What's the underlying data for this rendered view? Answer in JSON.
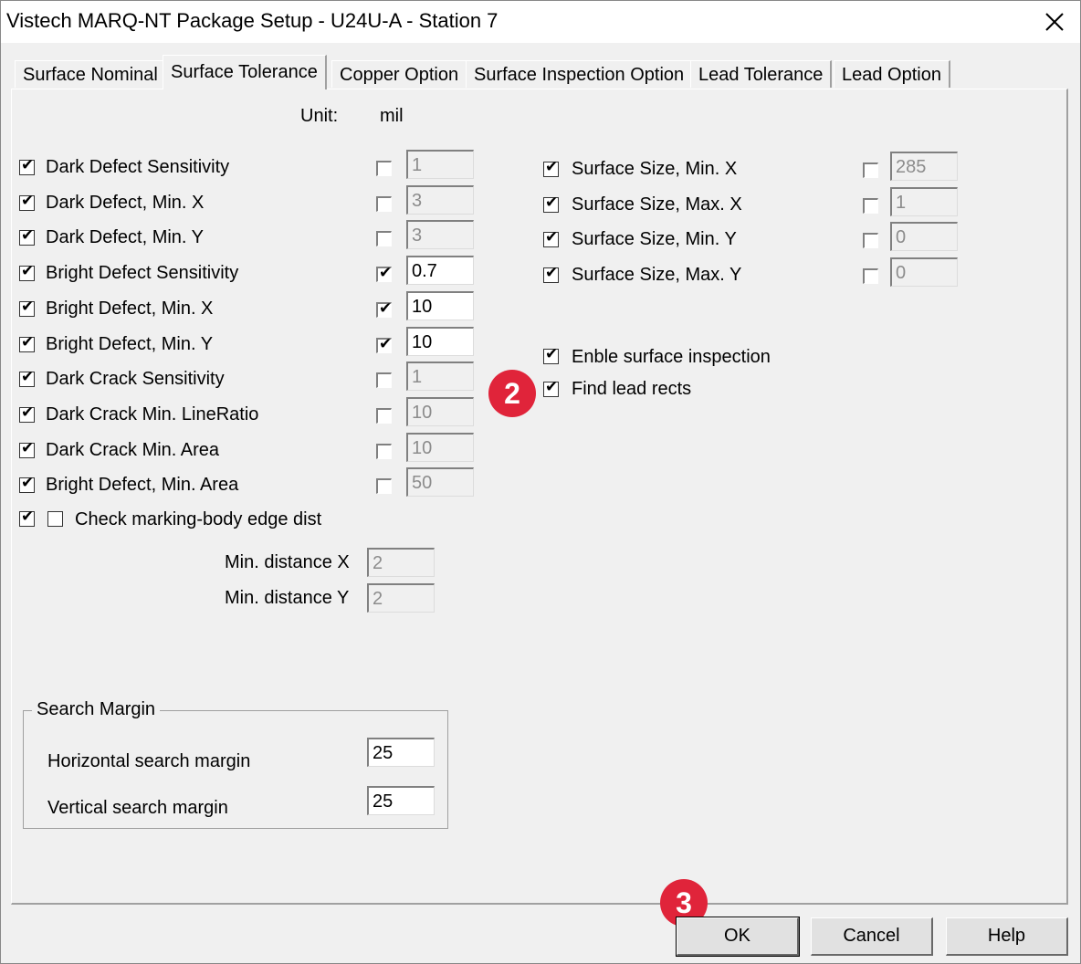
{
  "window": {
    "title": "Vistech MARQ-NT Package Setup - U24U-A - Station 7"
  },
  "tabs": [
    {
      "label": "Surface Nominal"
    },
    {
      "label": "Surface Tolerance"
    },
    {
      "label": "Copper Option"
    },
    {
      "label": "Surface Inspection Option"
    },
    {
      "label": "Lead Tolerance"
    },
    {
      "label": "Lead Option"
    }
  ],
  "unit": {
    "label": "Unit:",
    "value": "mil"
  },
  "left_params": [
    {
      "label": "Dark Defect Sensitivity",
      "checked": true,
      "override": false,
      "value": "1"
    },
    {
      "label": "Dark Defect, Min. X",
      "checked": true,
      "override": false,
      "value": "3"
    },
    {
      "label": "Dark Defect, Min. Y",
      "checked": true,
      "override": false,
      "value": "3"
    },
    {
      "label": "Bright Defect Sensitivity",
      "checked": true,
      "override": true,
      "value": "0.7"
    },
    {
      "label": "Bright Defect, Min. X",
      "checked": true,
      "override": true,
      "value": "10"
    },
    {
      "label": "Bright Defect, Min. Y",
      "checked": true,
      "override": true,
      "value": "10"
    },
    {
      "label": "Dark Crack Sensitivity",
      "checked": true,
      "override": false,
      "value": "1"
    },
    {
      "label": "Dark Crack Min. LineRatio",
      "checked": true,
      "override": false,
      "value": "10"
    },
    {
      "label": "Dark Crack Min. Area",
      "checked": true,
      "override": false,
      "value": "10"
    },
    {
      "label": "Bright Defect, Min. Area",
      "checked": true,
      "override": false,
      "value": "50"
    }
  ],
  "right_params": [
    {
      "label": "Surface Size, Min. X",
      "checked": true,
      "override": false,
      "value": "285"
    },
    {
      "label": "Surface Size, Max. X",
      "checked": true,
      "override": false,
      "value": "1"
    },
    {
      "label": "Surface Size, Min. Y",
      "checked": true,
      "override": false,
      "value": "0"
    },
    {
      "label": "Surface Size, Max. Y",
      "checked": true,
      "override": false,
      "value": "0"
    }
  ],
  "options": {
    "enable_surface": {
      "label": "Enble surface inspection",
      "checked": true
    },
    "find_lead_rects": {
      "label": "Find lead rects",
      "checked": true
    }
  },
  "marking": {
    "label": "Check marking-body edge dist",
    "outer_checked": true,
    "inner_checked": false,
    "min_x_label": "Min. distance X",
    "min_x_value": "2",
    "min_y_label": "Min. distance Y",
    "min_y_value": "2"
  },
  "search_margin": {
    "title": "Search Margin",
    "horizontal_label": "Horizontal search margin",
    "horizontal_value": "25",
    "vertical_label": "Vertical search margin",
    "vertical_value": "25"
  },
  "badges": {
    "badge_2": "2",
    "badge_3": "3"
  },
  "buttons": {
    "ok": "OK",
    "cancel": "Cancel",
    "help": "Help"
  },
  "colors": {
    "badge": "#e0243a",
    "background": "#f0f0f0",
    "disabled_text": "#8c8c8c"
  }
}
